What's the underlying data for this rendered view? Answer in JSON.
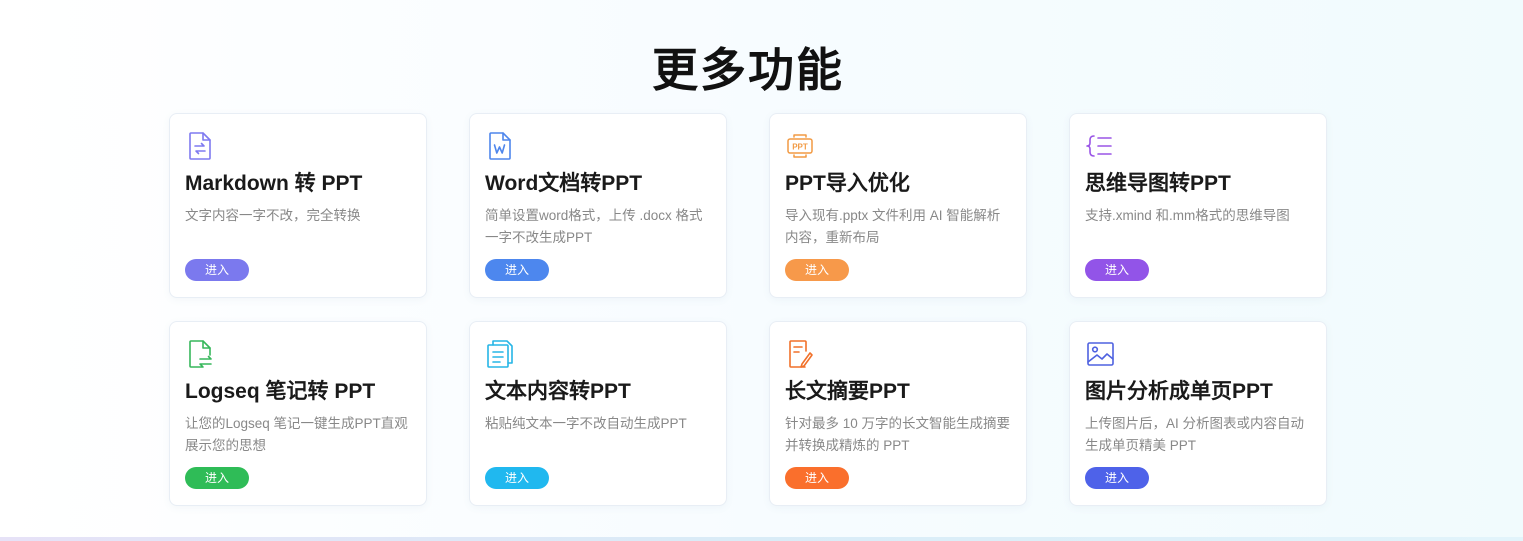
{
  "section": {
    "title": "更多功能"
  },
  "cards": [
    {
      "title": "Markdown 转 PPT",
      "desc": "文字内容一字不改，完全转换",
      "button": "进入",
      "icon": "markdown-file-icon",
      "color": "#7f7af0",
      "btn_color": "#7b79ee"
    },
    {
      "title": "Word文档转PPT",
      "desc": "简单设置word格式，上传 .docx 格式一字不改生成PPT",
      "button": "进入",
      "icon": "word-file-icon",
      "color": "#4e86ec",
      "btn_color": "#4d87ee"
    },
    {
      "title": "PPT导入优化",
      "desc": "导入现有.pptx 文件利用 AI 智能解析内容，重新布局",
      "button": "进入",
      "icon": "ppt-import-icon",
      "color": "#f29a43",
      "btn_color": "#f7994a"
    },
    {
      "title": "思维导图转PPT",
      "desc": "支持.xmind 和.mm格式的思维导图",
      "button": "进入",
      "icon": "mindmap-icon",
      "color": "#9a55e6",
      "btn_color": "#9254e8"
    },
    {
      "title": "Logseq 笔记转 PPT",
      "desc": "让您的Logseq 笔记一键生成PPT直观展示您的思想",
      "button": "进入",
      "icon": "logseq-file-icon",
      "color": "#37b75b",
      "btn_color": "#2fbc57"
    },
    {
      "title": "文本内容转PPT",
      "desc": "粘贴纯文本一字不改自动生成PPT",
      "button": "进入",
      "icon": "text-document-icon",
      "color": "#26b5e6",
      "btn_color": "#20b8ef"
    },
    {
      "title": "长文摘要PPT",
      "desc": "针对最多 10 万字的长文智能生成摘要并转换成精炼的 PPT",
      "button": "进入",
      "icon": "long-text-edit-icon",
      "color": "#f1712a",
      "btn_color": "#fa6f2c"
    },
    {
      "title": "图片分析成单页PPT",
      "desc": "上传图片后，AI 分析图表或内容自动生成单页精美 PPT",
      "button": "进入",
      "icon": "image-icon",
      "color": "#4f62e0",
      "btn_color": "#4e62e9"
    }
  ]
}
